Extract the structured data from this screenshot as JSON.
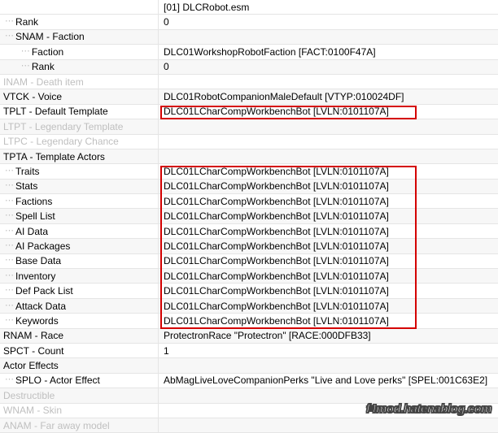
{
  "header": {
    "plugin": "[01] DLCRobot.esm"
  },
  "rows": [
    {
      "label": "Rank",
      "value": "0",
      "indent": 1,
      "alt": false,
      "dim": false,
      "tree": true
    },
    {
      "label": "SNAM - Faction",
      "value": "",
      "indent": 1,
      "alt": true,
      "dim": false,
      "tree": true
    },
    {
      "label": "Faction",
      "value": "DLC01WorkshopRobotFaction [FACT:0100F47A]",
      "indent": 2,
      "alt": false,
      "dim": false,
      "tree": true
    },
    {
      "label": "Rank",
      "value": "0",
      "indent": 2,
      "alt": true,
      "dim": false,
      "tree": true
    },
    {
      "label": "INAM - Death item",
      "value": "",
      "indent": 0,
      "alt": false,
      "dim": true,
      "tree": false
    },
    {
      "label": "VTCK - Voice",
      "value": "DLC01RobotCompanionMaleDefault [VTYP:010024DF]",
      "indent": 0,
      "alt": true,
      "dim": false,
      "tree": false
    },
    {
      "label": "TPLT - Default Template",
      "value": "DLC01LCharCompWorkbenchBot [LVLN:0101107A]",
      "indent": 0,
      "alt": false,
      "dim": false,
      "tree": false
    },
    {
      "label": "LTPT - Legendary Template",
      "value": "",
      "indent": 0,
      "alt": true,
      "dim": true,
      "tree": false
    },
    {
      "label": "LTPC - Legendary Chance",
      "value": "",
      "indent": 0,
      "alt": false,
      "dim": true,
      "tree": false
    },
    {
      "label": "TPTA - Template Actors",
      "value": "",
      "indent": 0,
      "alt": true,
      "dim": false,
      "tree": false
    },
    {
      "label": "Traits",
      "value": "DLC01LCharCompWorkbenchBot [LVLN:0101107A]",
      "indent": 1,
      "alt": false,
      "dim": false,
      "tree": true
    },
    {
      "label": "Stats",
      "value": "DLC01LCharCompWorkbenchBot [LVLN:0101107A]",
      "indent": 1,
      "alt": true,
      "dim": false,
      "tree": true
    },
    {
      "label": "Factions",
      "value": "DLC01LCharCompWorkbenchBot [LVLN:0101107A]",
      "indent": 1,
      "alt": false,
      "dim": false,
      "tree": true
    },
    {
      "label": "Spell List",
      "value": "DLC01LCharCompWorkbenchBot [LVLN:0101107A]",
      "indent": 1,
      "alt": true,
      "dim": false,
      "tree": true
    },
    {
      "label": "AI Data",
      "value": "DLC01LCharCompWorkbenchBot [LVLN:0101107A]",
      "indent": 1,
      "alt": false,
      "dim": false,
      "tree": true
    },
    {
      "label": "AI Packages",
      "value": "DLC01LCharCompWorkbenchBot [LVLN:0101107A]",
      "indent": 1,
      "alt": true,
      "dim": false,
      "tree": true
    },
    {
      "label": "Base Data",
      "value": "DLC01LCharCompWorkbenchBot [LVLN:0101107A]",
      "indent": 1,
      "alt": false,
      "dim": false,
      "tree": true
    },
    {
      "label": "Inventory",
      "value": "DLC01LCharCompWorkbenchBot [LVLN:0101107A]",
      "indent": 1,
      "alt": true,
      "dim": false,
      "tree": true
    },
    {
      "label": "Def Pack List",
      "value": "DLC01LCharCompWorkbenchBot [LVLN:0101107A]",
      "indent": 1,
      "alt": false,
      "dim": false,
      "tree": true
    },
    {
      "label": "Attack Data",
      "value": "DLC01LCharCompWorkbenchBot [LVLN:0101107A]",
      "indent": 1,
      "alt": true,
      "dim": false,
      "tree": true
    },
    {
      "label": "Keywords",
      "value": "DLC01LCharCompWorkbenchBot [LVLN:0101107A]",
      "indent": 1,
      "alt": false,
      "dim": false,
      "tree": true
    },
    {
      "label": "RNAM - Race",
      "value": "ProtectronRace \"Protectron\" [RACE:000DFB33]",
      "indent": 0,
      "alt": true,
      "dim": false,
      "tree": false
    },
    {
      "label": "SPCT - Count",
      "value": "1",
      "indent": 0,
      "alt": false,
      "dim": false,
      "tree": false
    },
    {
      "label": "Actor Effects",
      "value": "",
      "indent": 0,
      "alt": true,
      "dim": false,
      "tree": false
    },
    {
      "label": "SPLO - Actor Effect",
      "value": "AbMagLiveLoveCompanionPerks \"Live and Love perks\" [SPEL:001C63E2]",
      "indent": 1,
      "alt": false,
      "dim": false,
      "tree": true
    },
    {
      "label": "Destructible",
      "value": "",
      "indent": 0,
      "alt": true,
      "dim": true,
      "tree": false
    },
    {
      "label": "WNAM - Skin",
      "value": "",
      "indent": 0,
      "alt": false,
      "dim": true,
      "tree": false
    },
    {
      "label": "ANAM - Far away model",
      "value": "",
      "indent": 0,
      "alt": true,
      "dim": true,
      "tree": false
    }
  ],
  "watermark": "f4mod.hatenablog.com"
}
